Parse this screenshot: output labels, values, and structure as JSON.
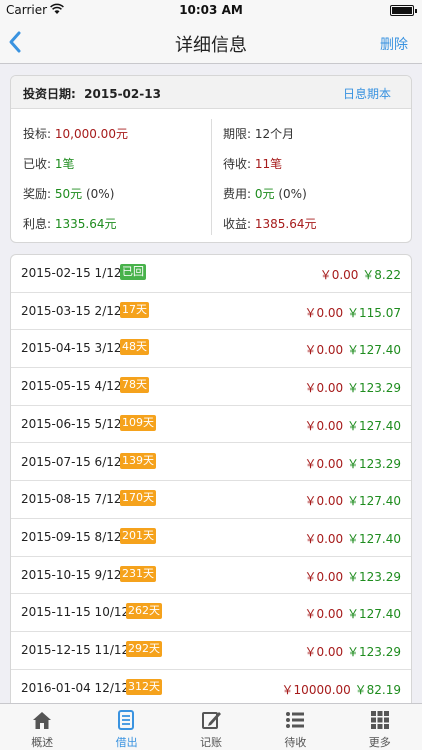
{
  "status": {
    "carrier": "Carrier",
    "time": "10:03 AM"
  },
  "nav": {
    "title": "详细信息",
    "delete_label": "删除"
  },
  "summary": {
    "date_label": "投资日期:",
    "date_value": "2015-02-13",
    "mode_label": "日息期本",
    "principal_label": "投标:",
    "principal_value": "10,000.00元",
    "term_label": "期限:",
    "term_value": "12个月",
    "received_label": "已收:",
    "received_value": "1笔",
    "pending_label": "待收:",
    "pending_value": "11笔",
    "reward_label": "奖励:",
    "reward_value": "50元",
    "reward_pct": "(0%)",
    "fee_label": "费用:",
    "fee_value": "0元",
    "fee_pct": "(0%)",
    "interest_label": "利息:",
    "interest_value": "1335.64元",
    "income_label": "收益:",
    "income_value": "1385.64元"
  },
  "schedule": [
    {
      "date": "2015-02-15 1/12",
      "badge": "已回",
      "status": "done",
      "principal": "￥0.00",
      "interest": "￥8.22"
    },
    {
      "date": "2015-03-15 2/12",
      "badge": "17天",
      "status": "pending",
      "principal": "￥0.00",
      "interest": "￥115.07"
    },
    {
      "date": "2015-04-15 3/12",
      "badge": "48天",
      "status": "pending",
      "principal": "￥0.00",
      "interest": "￥127.40"
    },
    {
      "date": "2015-05-15 4/12",
      "badge": "78天",
      "status": "pending",
      "principal": "￥0.00",
      "interest": "￥123.29"
    },
    {
      "date": "2015-06-15 5/12",
      "badge": "109天",
      "status": "pending",
      "principal": "￥0.00",
      "interest": "￥127.40"
    },
    {
      "date": "2015-07-15 6/12",
      "badge": "139天",
      "status": "pending",
      "principal": "￥0.00",
      "interest": "￥123.29"
    },
    {
      "date": "2015-08-15 7/12",
      "badge": "170天",
      "status": "pending",
      "principal": "￥0.00",
      "interest": "￥127.40"
    },
    {
      "date": "2015-09-15 8/12",
      "badge": "201天",
      "status": "pending",
      "principal": "￥0.00",
      "interest": "￥127.40"
    },
    {
      "date": "2015-10-15 9/12",
      "badge": "231天",
      "status": "pending",
      "principal": "￥0.00",
      "interest": "￥123.29"
    },
    {
      "date": "2015-11-15 10/12",
      "badge": "262天",
      "status": "pending",
      "principal": "￥0.00",
      "interest": "￥127.40"
    },
    {
      "date": "2015-12-15 11/12",
      "badge": "292天",
      "status": "pending",
      "principal": "￥0.00",
      "interest": "￥123.29"
    },
    {
      "date": "2016-01-04 12/12",
      "badge": "312天",
      "status": "pending",
      "principal": "￥10000.00",
      "interest": "￥82.19"
    }
  ],
  "tabs": [
    {
      "label": "概述",
      "icon": "home-icon",
      "active": false
    },
    {
      "label": "借出",
      "icon": "document-icon",
      "active": true
    },
    {
      "label": "记账",
      "icon": "edit-icon",
      "active": false
    },
    {
      "label": "待收",
      "icon": "list-icon",
      "active": false
    },
    {
      "label": "更多",
      "icon": "grid-icon",
      "active": false
    }
  ],
  "colors": {
    "accent": "#3a93e0",
    "red": "#a61b1b",
    "green": "#1e8c1e",
    "badge_pending": "#f5a21c",
    "badge_done": "#48b24b"
  }
}
